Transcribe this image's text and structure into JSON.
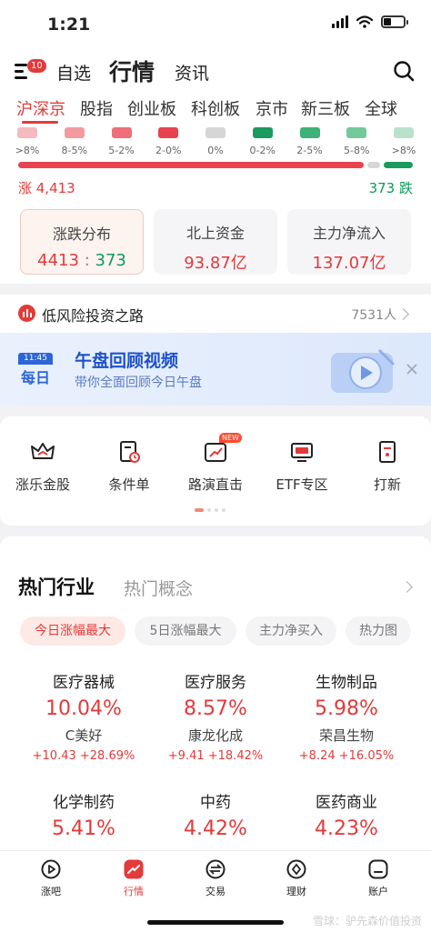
{
  "status_bar": {
    "time": "1:21"
  },
  "header": {
    "menu_badge": "10",
    "tabs": [
      {
        "label": "自选",
        "active": false
      },
      {
        "label": "行情",
        "active": true
      },
      {
        "label": "资讯",
        "active": false
      }
    ]
  },
  "market_tabs": [
    {
      "label": "沪深京",
      "active": true
    },
    {
      "label": "股指",
      "active": false
    },
    {
      "label": "创业板",
      "active": false
    },
    {
      "label": "科创板",
      "active": false
    },
    {
      "label": "京市",
      "active": false
    },
    {
      "label": "新三板",
      "active": false
    },
    {
      "label": "全球",
      "active": false
    }
  ],
  "distribution": {
    "buckets": [
      {
        "label": ">8%",
        "color": "#f6b9bd"
      },
      {
        "label": "8-5%",
        "color": "#f39aa0"
      },
      {
        "label": "5-2%",
        "color": "#ee6f78"
      },
      {
        "label": "2-0%",
        "color": "#e8434f"
      },
      {
        "label": "0%",
        "color": "#d6d6d6"
      },
      {
        "label": "0-2%",
        "color": "#1a9a5e"
      },
      {
        "label": "2-5%",
        "color": "#3cb277"
      },
      {
        "label": "5-8%",
        "color": "#72c99b"
      },
      {
        "label": ">8%",
        "color": "#b8e3ca"
      }
    ],
    "up_count": "涨 4,413",
    "down_count": "373 跌",
    "up_fraction": 0.922,
    "up_color": "#e8434f",
    "down_color": "#1a9a5e"
  },
  "cards": {
    "updown": {
      "title": "涨跌分布",
      "up": "4413",
      "sep": ":",
      "down": "373"
    },
    "northbound": {
      "title": "北上资金",
      "value": "93.87亿"
    },
    "mainflow": {
      "title": "主力净流入",
      "value": "137.07亿"
    }
  },
  "invest": {
    "title": "低风险投资之路",
    "count": "7531人"
  },
  "banner": {
    "badge_time": "11:45",
    "badge_word": "每日",
    "title": "午盘回顾视频",
    "subtitle": "带你全面回顾今日午盘"
  },
  "shortcuts": [
    {
      "label": "涨乐金股",
      "icon": "crown-icon"
    },
    {
      "label": "条件单",
      "icon": "clock-document-icon"
    },
    {
      "label": "路演直击",
      "icon": "trend-icon",
      "tag": "NEW"
    },
    {
      "label": "ETF专区",
      "icon": "etf-icon"
    },
    {
      "label": "打新",
      "icon": "ticket-icon"
    }
  ],
  "industry": {
    "tab_main": "热门行业",
    "tab_secondary": "热门概念",
    "chips": [
      {
        "label": "今日涨幅最大",
        "active": true
      },
      {
        "label": "5日涨幅最大",
        "active": false
      },
      {
        "label": "主力净买入",
        "active": false
      },
      {
        "label": "热力图",
        "active": false
      }
    ],
    "items": [
      {
        "name": "医疗器械",
        "pct": "10.04%",
        "stock": "C美好",
        "change": "+10.43 +28.69%"
      },
      {
        "name": "医疗服务",
        "pct": "8.57%",
        "stock": "康龙化成",
        "change": "+9.41 +18.42%"
      },
      {
        "name": "生物制品",
        "pct": "5.98%",
        "stock": "荣昌生物",
        "change": "+8.24 +16.05%"
      },
      {
        "name": "化学制药",
        "pct": "5.41%",
        "stock": "",
        "change": ""
      },
      {
        "name": "中药",
        "pct": "4.42%",
        "stock": "",
        "change": ""
      },
      {
        "name": "医药商业",
        "pct": "4.23%",
        "stock": "",
        "change": ""
      }
    ]
  },
  "bottom_nav": [
    {
      "label": "涨吧",
      "icon": "play-circle-icon",
      "active": false
    },
    {
      "label": "行情",
      "icon": "chart-up-icon",
      "active": true
    },
    {
      "label": "交易",
      "icon": "exchange-icon",
      "active": false
    },
    {
      "label": "理财",
      "icon": "diamond-icon",
      "active": false
    },
    {
      "label": "账户",
      "icon": "account-icon",
      "active": false
    }
  ],
  "watermark": "雪球：驴先森价值投资"
}
